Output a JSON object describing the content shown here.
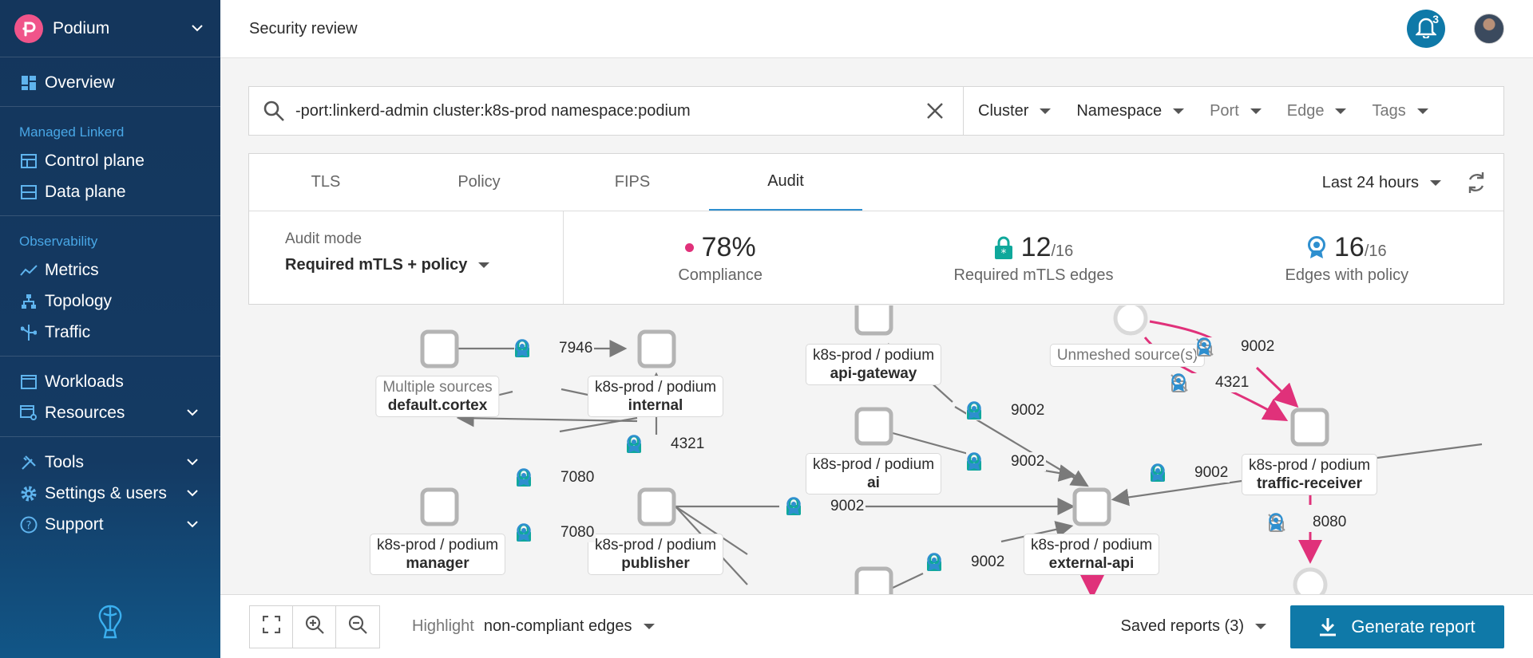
{
  "app": {
    "name": "Podium"
  },
  "sidebar": {
    "overview": "Overview",
    "sections": {
      "managed": "Managed Linkerd",
      "observability": "Observability"
    },
    "control_plane": "Control plane",
    "data_plane": "Data plane",
    "metrics": "Metrics",
    "topology": "Topology",
    "traffic": "Traffic",
    "workloads": "Workloads",
    "resources": "Resources",
    "tools": "Tools",
    "settings": "Settings & users",
    "support": "Support"
  },
  "header": {
    "title": "Security review",
    "notification_count": "3"
  },
  "search": {
    "query": "-port:linkerd-admin cluster:k8s-prod namespace:podium",
    "filters": {
      "cluster": "Cluster",
      "namespace": "Namespace",
      "port": "Port",
      "edge": "Edge",
      "tags": "Tags"
    }
  },
  "tabs": {
    "tls": "TLS",
    "policy": "Policy",
    "fips": "FIPS",
    "audit": "Audit",
    "active": "Audit"
  },
  "time_range": "Last 24 hours",
  "audit": {
    "mode_label": "Audit mode",
    "mode_value": "Required mTLS + policy",
    "compliance": {
      "value": "78%",
      "label": "Compliance"
    },
    "mtls": {
      "value": "12",
      "total": "/16",
      "label": "Required mTLS edges"
    },
    "policy": {
      "value": "16",
      "total": "/16",
      "label": "Edges with policy"
    }
  },
  "graph": {
    "nodes": {
      "cortex": {
        "ns": "Multiple sources",
        "name": "default.cortex"
      },
      "internal": {
        "ns": "k8s-prod / podium",
        "name": "internal"
      },
      "manager": {
        "ns": "k8s-prod / podium",
        "name": "manager"
      },
      "publisher": {
        "ns": "k8s-prod / podium",
        "name": "publisher"
      },
      "api_gateway": {
        "ns": "k8s-prod / podium",
        "name": "api-gateway"
      },
      "ai": {
        "ns": "k8s-prod / podium",
        "name": "ai"
      },
      "external_api": {
        "ns": "k8s-prod / podium",
        "name": "external-api"
      },
      "unmeshed": {
        "ns": "Unmeshed source(s)"
      },
      "traffic_receiver": {
        "ns": "k8s-prod / podium",
        "name": "traffic-receiver"
      }
    },
    "edges": {
      "cortex_internal": "7946",
      "publisher_internal": "4321",
      "publisher_manager_a": "7080",
      "publisher_manager_b": "7080",
      "publisher_external": "9002",
      "apigw_external": "9002",
      "ai_external": "9002",
      "bottom_external": "9002",
      "receiver_external": "9002",
      "unmeshed_receiver_a": "9002",
      "unmeshed_receiver_b": "4321",
      "receiver_down": "8080"
    },
    "colors": {
      "compliant": "#0fa89b",
      "policy": "#2e8fcf",
      "noncompliant": "#e0317a",
      "edge": "#7a7a7a"
    }
  },
  "bottom": {
    "highlight_label": "Highlight",
    "highlight_value": "non-compliant edges",
    "saved_reports": "Saved reports (3)",
    "generate": "Generate report"
  }
}
